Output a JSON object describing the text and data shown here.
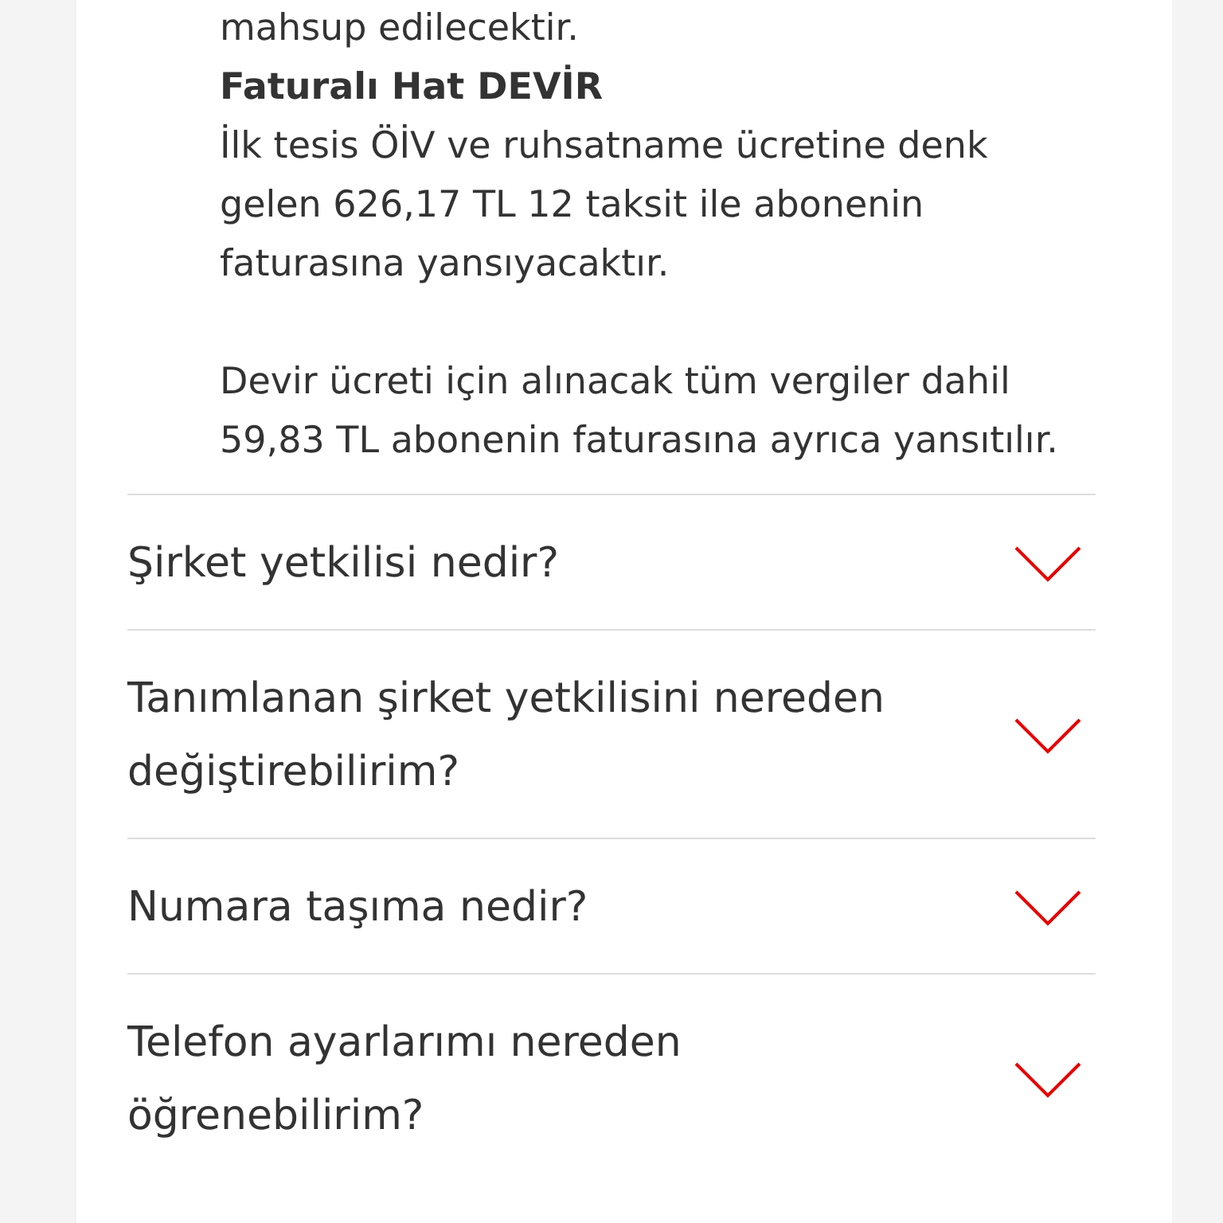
{
  "answer": {
    "blocks": [
      {
        "kind": "text",
        "text": "mahsup edilecektir."
      },
      {
        "kind": "heading",
        "text": "Faturalı Hat DEVİR"
      },
      {
        "kind": "text",
        "text": "İlk tesis ÖİV ve ruhsatname ücretine denk gelen 626,17 TL 12 taksit ile abonenin faturasına yansıyacaktır."
      },
      {
        "kind": "text",
        "text": "Devir ücreti için alınacak tüm vergiler dahil 59,83 TL abonenin faturasına ayrıca yansıtılır.",
        "spaced": true
      }
    ]
  },
  "faq": [
    {
      "question": "Şirket yetkilisi nedir?",
      "expanded": false
    },
    {
      "question": "Tanımlanan şirket yetkilisini nereden değiştirebilirim?",
      "expanded": false
    },
    {
      "question": "Numara taşıma nedir?",
      "expanded": false
    },
    {
      "question": "Telefon ayarlarımı nereden öğrenebilirim?",
      "expanded": false
    }
  ]
}
